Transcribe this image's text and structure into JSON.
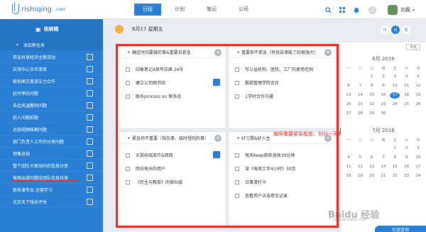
{
  "app": {
    "brand": "rishiqing",
    "domain": ".com"
  },
  "nav": {
    "tabs": [
      {
        "label": "日程"
      },
      {
        "label": "计划"
      },
      {
        "label": "笔记"
      },
      {
        "label": "公司"
      }
    ],
    "active": 0
  },
  "topbar": {
    "icons": [
      "search-icon",
      "grid-icon",
      "bell-icon",
      "settings-icon"
    ],
    "username": "刘磊"
  },
  "sidebar": {
    "title": "收纳箱",
    "add_label": "添加新任务",
    "items": [
      {
        "label": "参加共享经济主题活动"
      },
      {
        "label": "应用中心合作清单"
      },
      {
        "label": "联系图文美读又力合作"
      },
      {
        "label": "赵丹亭的问题"
      },
      {
        "label": "朱金风温教师问题"
      },
      {
        "label": "前人问题前题"
      },
      {
        "label": "运指视频帐期问题"
      },
      {
        "label": "部门负责人工作的分享问题"
      },
      {
        "label": "销售总结"
      },
      {
        "label": "整个团队大家动向的信息分享"
      },
      {
        "label": "每周出游问题全团队信息共享"
      },
      {
        "label": "联系演专出 运营学习"
      },
      {
        "label": "北京天下钱总评估"
      }
    ]
  },
  "main": {
    "date": "6月17 星期五",
    "views": [
      "月",
      "日",
      "周"
    ],
    "active_view": 1,
    "quadrants": [
      {
        "title": "确定时间要做的事&重要且紧急",
        "tasks": [
          {
            "text": "印象笔记4周年庆典 24号"
          },
          {
            "text": "建立公司图书馆"
          },
          {
            "text": "联系process on 联系总"
          }
        ]
      },
      {
        "title": "重要但不紧急（有就自律能了的很强大）",
        "tasks": [
          {
            "text": "写公益机构、医院、工厂的使用范例"
          },
          {
            "text": "鹏程管理学院合作"
          },
          {
            "text": "1学时合作沟通"
          }
        ]
      },
      {
        "title": "紧急但不重要（指杂事、临时想到的事）",
        "tasks": [
          {
            "text": "买挺校结亚玲&西西"
          },
          {
            "text": "回访每天的用户"
          },
          {
            "text": "《民主与教育》的微社威"
          }
        ]
      },
      {
        "title": "好习惯&好人生",
        "tasks": [
          {
            "text": "每天Keep跑练身体30分钟"
          },
          {
            "text": "读《每周工作4小时》30页"
          },
          {
            "text": "日事清打卡"
          },
          {
            "text": "查看用户访谈意见记录"
          }
        ]
      }
    ],
    "annotation": "按照重要紧急程度，划分一天的工作。"
  },
  "calendar": {
    "today_label": "今天",
    "weekdays": [
      "一",
      "二",
      "三",
      "四",
      "五",
      "六",
      "日"
    ],
    "months": [
      {
        "title": "6月 2016",
        "days": [
          "",
          "",
          "1",
          "2",
          "3",
          "4",
          "5",
          "6",
          "7",
          "8",
          "9",
          "10",
          "11",
          "12",
          "13",
          "14",
          "15",
          "16",
          "17",
          "18",
          "19",
          "20",
          "21",
          "22",
          "23",
          "24",
          "25",
          "26",
          "27",
          "28",
          "29",
          "30",
          "",
          "",
          ""
        ],
        "selected": "17"
      },
      {
        "title": "7月 2016",
        "days": [
          "",
          "",
          "",
          "",
          "1",
          "2",
          "3",
          "4",
          "5",
          "6",
          "7",
          "8",
          "9",
          "10",
          "11",
          "12",
          "13",
          "14",
          "15",
          "16",
          "17",
          "18",
          "19",
          "20",
          "21",
          "22",
          "23",
          "24"
        ]
      }
    ]
  },
  "help": {
    "label": "在线咨询"
  },
  "watermark": {
    "text": "Baidu 经验",
    "sub": "jingyan.baidu.com"
  }
}
